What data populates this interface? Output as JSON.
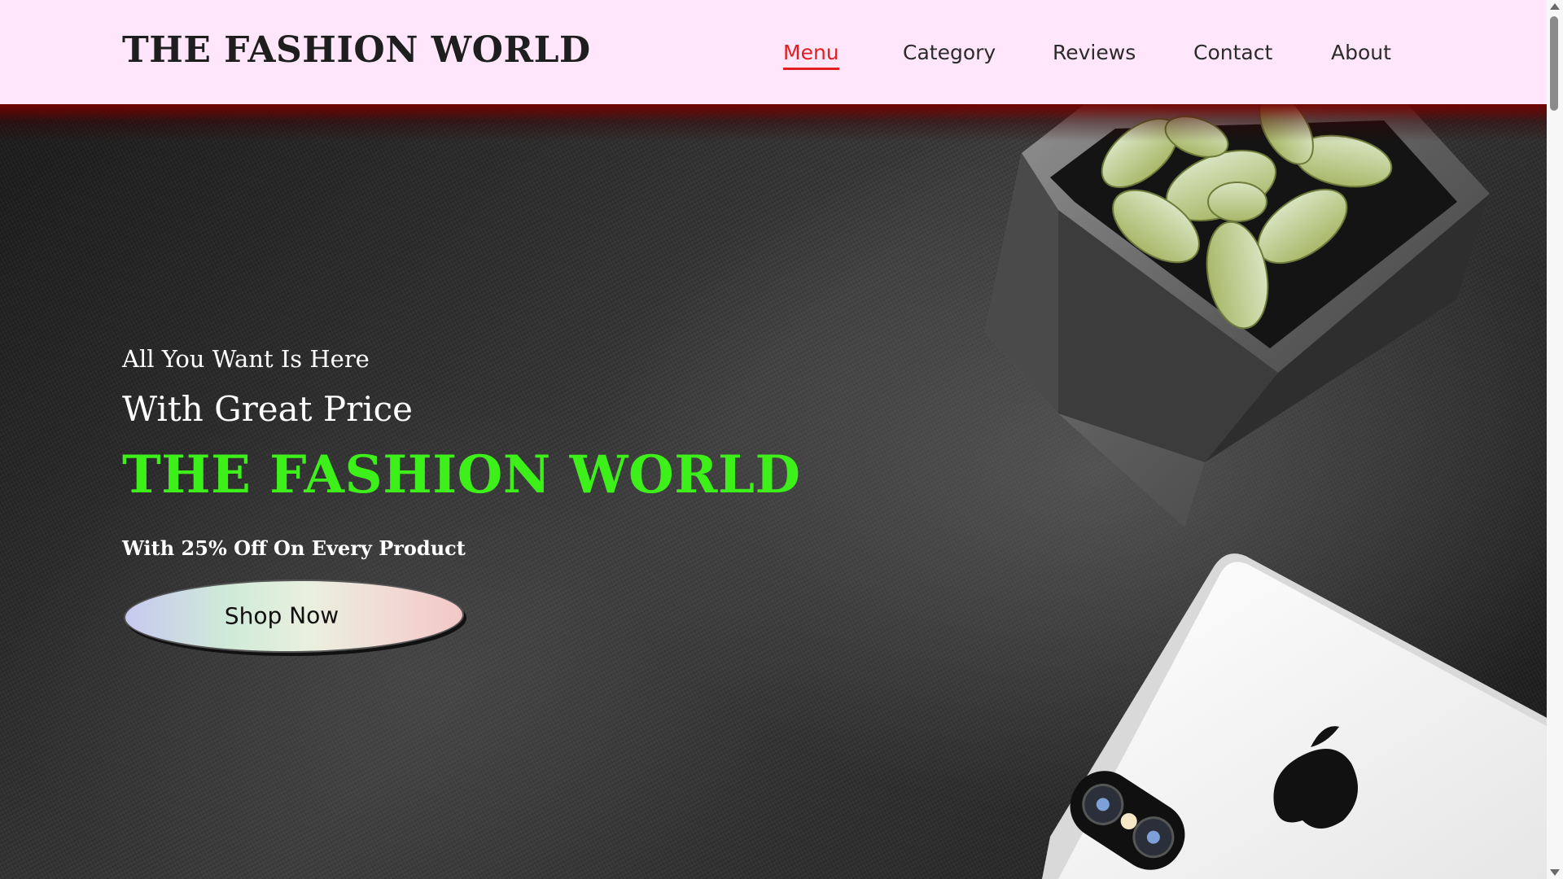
{
  "header": {
    "brand": "THE FASHION WORLD",
    "nav": [
      {
        "label": "Menu",
        "active": true
      },
      {
        "label": "Category",
        "active": false
      },
      {
        "label": "Reviews",
        "active": false
      },
      {
        "label": "Contact",
        "active": false
      },
      {
        "label": "About",
        "active": false
      }
    ]
  },
  "hero": {
    "tagline_small": "All You Want Is Here",
    "tagline_mid": "With Great Price",
    "title": "THE FASHION WORLD",
    "offer": "With 25% Off On Every Product",
    "cta_label": "Shop Now",
    "image_subjects": [
      "succulent-plant",
      "smartphone"
    ]
  },
  "colors": {
    "header_bg": "#ffe6fb",
    "nav_active": "#e02020",
    "title_green": "#3ef01a"
  }
}
